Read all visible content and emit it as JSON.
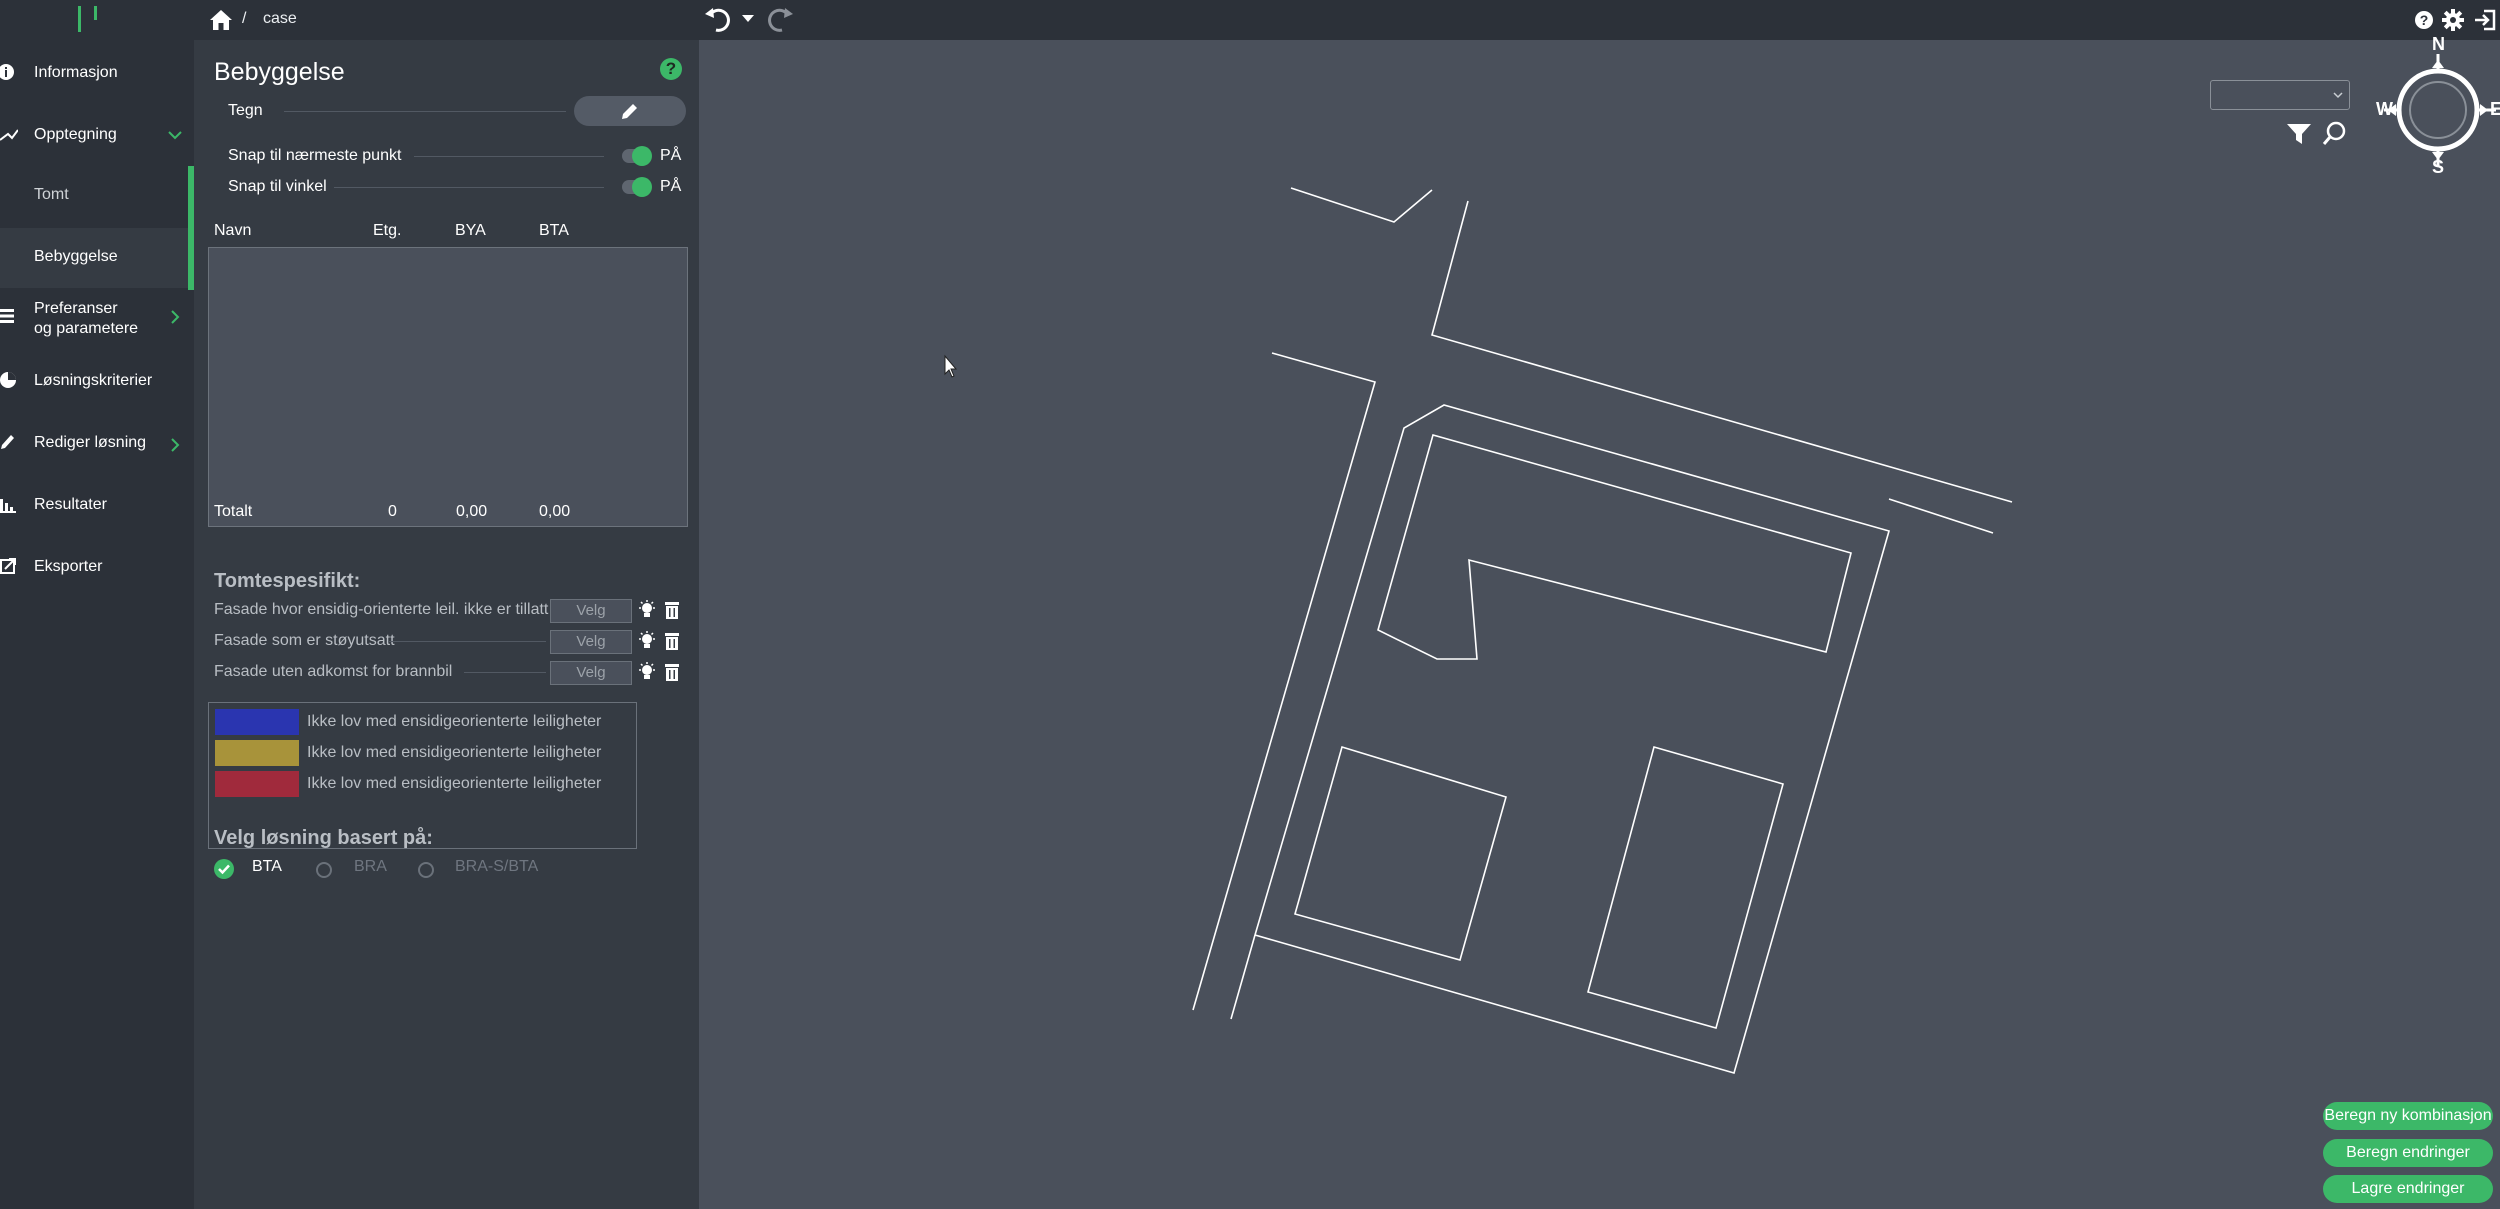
{
  "topbar": {
    "breadcrumb_sep": "/",
    "breadcrumb_current": "case"
  },
  "sidebar": {
    "items": [
      {
        "label": "Informasjon",
        "icon": "info-icon"
      },
      {
        "label": "Opptegning",
        "icon": "draw-path-icon"
      },
      {
        "label": "Tomt"
      },
      {
        "label": "Bebyggelse"
      },
      {
        "label": "Preferanser",
        "label2": "og parametere",
        "icon": "list-icon"
      },
      {
        "label": "Løsningskriterier",
        "icon": "pie-chart-icon"
      },
      {
        "label": "Rediger løsning",
        "icon": "pencil-icon"
      },
      {
        "label": "Resultater",
        "icon": "bar-chart-icon"
      },
      {
        "label": "Eksporter",
        "icon": "export-icon"
      }
    ]
  },
  "panel": {
    "title": "Bebyggelse",
    "help": "?",
    "draw_label": "Tegn",
    "snap_point_label": "Snap til nærmeste punkt",
    "snap_point_state": "PÅ",
    "snap_angle_label": "Snap til vinkel",
    "snap_angle_state": "PÅ",
    "table": {
      "headers": [
        "Navn",
        "Etg.",
        "BYA",
        "BTA"
      ],
      "rows": [],
      "total_label": "Totalt",
      "total_etg": "0",
      "total_bya": "0,00",
      "total_bta": "0,00"
    },
    "tomtespesifikt": {
      "title": "Tomtespesifikt:",
      "facades": [
        {
          "label": "Fasade hvor ensidig-orienterte leil. ikke er tillatt",
          "button": "Velg"
        },
        {
          "label": "Fasade som er støyutsatt",
          "button": "Velg"
        },
        {
          "label": "Fasade uten adkomst for brannbil",
          "button": "Velg"
        }
      ]
    },
    "legend": [
      {
        "color": "#2a35b0",
        "label": "Ikke lov med ensidigeorienterte leiligheter"
      },
      {
        "color": "#a8933a",
        "label": "Ikke lov med ensidigeorienterte leiligheter"
      },
      {
        "color": "#a02a3c",
        "label": "Ikke lov med ensidigeorienterte leiligheter"
      }
    ],
    "solution_basis": {
      "title": "Velg løsning basert på:",
      "options": [
        {
          "label": "BTA",
          "selected": true
        },
        {
          "label": "BRA",
          "selected": false
        },
        {
          "label": "BRA-S/BTA",
          "selected": false
        }
      ]
    }
  },
  "map": {
    "compass": {
      "n": "N",
      "s": "S",
      "w": "W",
      "e": "E"
    },
    "buttons": [
      "Beregn ny kombinasjon",
      "Beregn endringer",
      "Lagre endringer"
    ]
  },
  "colors": {
    "accent": "#3cb868",
    "sidebar_bg": "#2c3139",
    "panel_bg": "#353b43",
    "canvas_bg": "#4a505b"
  }
}
